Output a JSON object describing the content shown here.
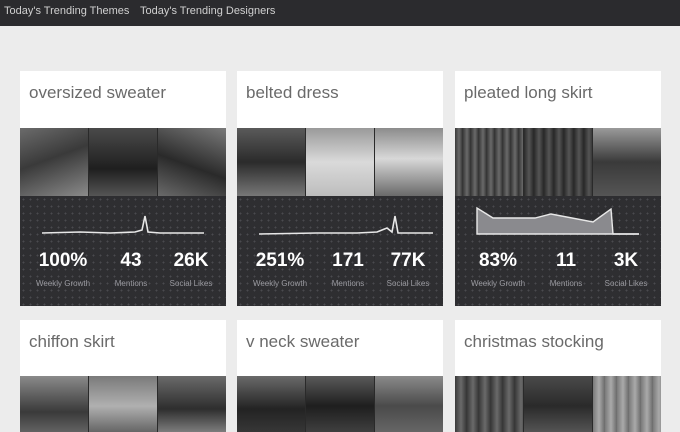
{
  "nav": {
    "items": [
      {
        "label": "Today's Trending Themes"
      },
      {
        "label": "Today's Trending Designers"
      }
    ]
  },
  "cards": [
    {
      "title": "oversized sweater",
      "stats": [
        {
          "value": "100%",
          "label": "Weekly Growth"
        },
        {
          "value": "43",
          "label": "Mentions"
        },
        {
          "value": "26K",
          "label": "Social Likes"
        }
      ]
    },
    {
      "title": "belted dress",
      "stats": [
        {
          "value": "251%",
          "label": "Weekly Growth"
        },
        {
          "value": "171",
          "label": "Mentions"
        },
        {
          "value": "77K",
          "label": "Social Likes"
        }
      ]
    },
    {
      "title": "pleated long skirt",
      "stats": [
        {
          "value": "83%",
          "label": "Weekly Growth"
        },
        {
          "value": "11",
          "label": "Mentions"
        },
        {
          "value": "3K",
          "label": "Social Likes"
        }
      ]
    },
    {
      "title": "chiffon skirt"
    },
    {
      "title": "v neck sweater"
    },
    {
      "title": "christmas stocking"
    }
  ],
  "colors": {
    "nav_background": "#2b2b2e",
    "page_background": "#ececec",
    "stats_background": "#2e2e31",
    "card_title": "#6a6a6a"
  }
}
